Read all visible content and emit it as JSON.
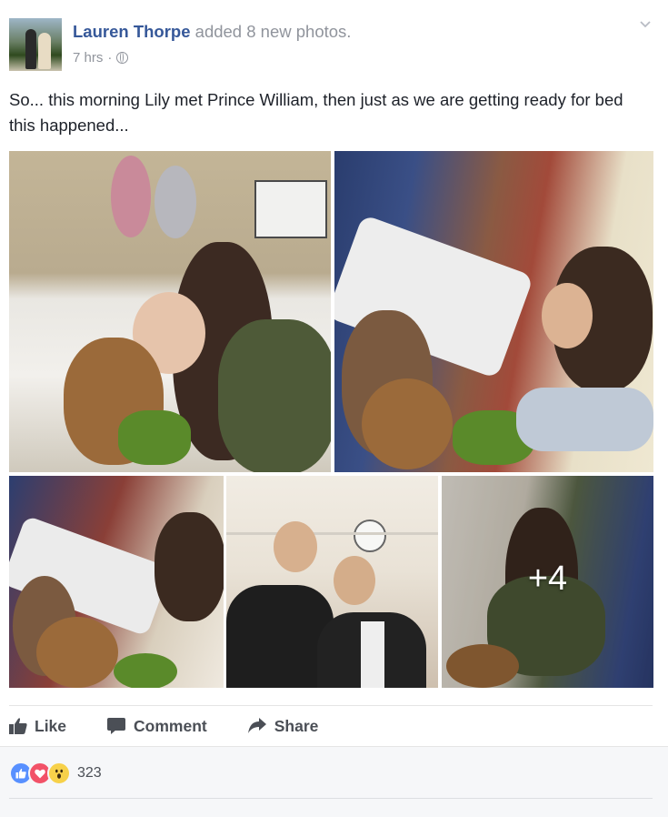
{
  "post": {
    "author": "Lauren Thorpe",
    "action": "added 8 new photos.",
    "timestamp": "7 hrs",
    "separator": "·",
    "privacy_icon": "globe-icon",
    "options_icon": "chevron-down-icon",
    "text": "So... this morning Lily met Prince William, then just as we are getting ready for bed this happened..."
  },
  "photos": {
    "more_count": "+4"
  },
  "actions": {
    "like_label": "Like",
    "comment_label": "Comment",
    "share_label": "Share"
  },
  "reactions": {
    "types": [
      "like-icon",
      "love-icon",
      "wow-icon"
    ],
    "count": "323"
  },
  "colors": {
    "author_link": "#365899",
    "secondary_text": "#90949c",
    "action_text": "#4b4f56",
    "like_blue": "#5890ff",
    "love_red": "#f25268",
    "wow_yellow": "#f7d14a"
  }
}
